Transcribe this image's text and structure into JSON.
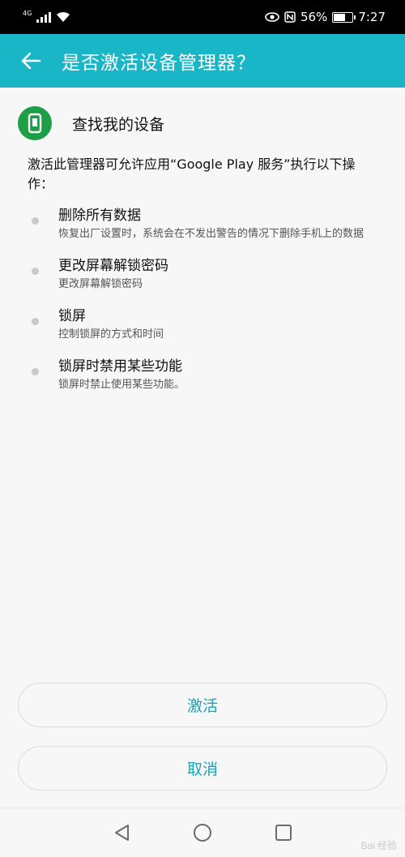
{
  "status_bar": {
    "network": "4G",
    "battery_percent": "56%",
    "battery_level": 0.56,
    "time": "7:27",
    "icons": [
      "eye-comfort-icon",
      "nfc-icon",
      "battery-charging-icon"
    ]
  },
  "app_bar": {
    "title": "是否激活设备管理器？",
    "back_icon": "arrow-left-icon",
    "color": "#19b6c8"
  },
  "header": {
    "title": "查找我的设备",
    "icon": "find-device-icon",
    "icon_color": "#1e9e47"
  },
  "description": "激活此管理器可允许应用“Google Play 服务”执行以下操作：",
  "permissions": [
    {
      "title": "删除所有数据",
      "desc": "恢复出厂设置时，系统会在不发出警告的情况下删除手机上的数据"
    },
    {
      "title": "更改屏幕解锁密码",
      "desc": "更改屏幕解锁密码"
    },
    {
      "title": "锁屏",
      "desc": "控制锁屏的方式和时间"
    },
    {
      "title": "锁屏时禁用某些功能",
      "desc": "锁屏时禁止使用某些功能。"
    }
  ],
  "buttons": {
    "activate": "激活",
    "cancel": "取消",
    "text_color": "#19a3b6"
  },
  "nav_bar": {
    "icons": [
      "back-triangle-icon",
      "home-circle-icon",
      "recents-square-icon"
    ]
  },
  "watermark": "Bai 经验"
}
